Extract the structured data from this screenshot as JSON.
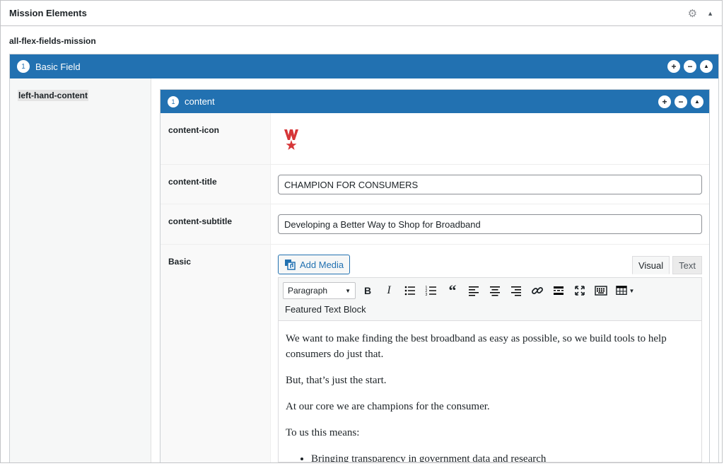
{
  "panel": {
    "title": "Mission Elements"
  },
  "field_name": "all-flex-fields-mission",
  "outer_layout": {
    "order": "1",
    "label": "Basic Field",
    "left_label": "left-hand-content"
  },
  "inner_layout": {
    "order": "1",
    "label": "content"
  },
  "fields": {
    "icon_label": "content-icon",
    "title_label": "content-title",
    "title_value": "CHAMPION FOR CONSUMERS",
    "subtitle_label": "content-subtitle",
    "subtitle_value": "Developing a Better Way to Shop for Broadband",
    "basic_label": "Basic"
  },
  "editor": {
    "add_media": "Add Media",
    "tab_visual": "Visual",
    "tab_text": "Text",
    "format_select": "Paragraph",
    "style_select": "Featured Text Block",
    "paragraphs": [
      "We want to make finding the best broadband as easy as possible, so we build tools to help consumers do just that.",
      "But, that’s just the start.",
      "At our core we are champions for the consumer.",
      "To us this means:"
    ],
    "bullets": [
      "Bringing transparency in government data and research"
    ]
  },
  "colors": {
    "accent": "#2271b1",
    "logo_red": "#d63638"
  }
}
